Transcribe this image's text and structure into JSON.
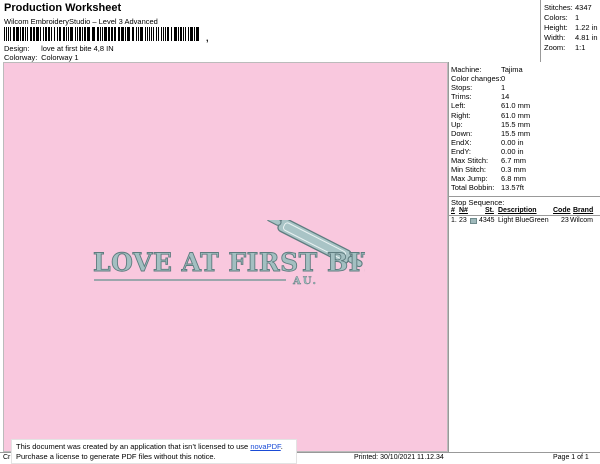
{
  "header": {
    "title": "Production Worksheet",
    "subtitle": "Wilcom EmbroideryStudio – Level 3 Advanced",
    "barcode_trailer": ",",
    "design_label": "Design:",
    "design_value": "love at first bite 4,8 IN",
    "colorway_label": "Colorway:",
    "colorway_value": "Colorway 1"
  },
  "stats": [
    {
      "label": "Stitches:",
      "value": "4347"
    },
    {
      "label": "Colors:",
      "value": "1"
    },
    {
      "label": "Height:",
      "value": "1.22 in"
    },
    {
      "label": "Width:",
      "value": "4.81 in"
    },
    {
      "label": "Zoom:",
      "value": "1:1"
    }
  ],
  "design": {
    "main_text": "LOVE AT FIRST BITE",
    "sub_text": "AU."
  },
  "properties": [
    {
      "label": "Machine:",
      "value": "Tajima"
    },
    {
      "label": "Color changes:",
      "value": "0"
    },
    {
      "label": "Stops:",
      "value": "1"
    },
    {
      "label": "Trims:",
      "value": "14"
    },
    {
      "label": "Left:",
      "value": "61.0 mm"
    },
    {
      "label": "Right:",
      "value": "61.0 mm"
    },
    {
      "label": "Up:",
      "value": "15.5 mm"
    },
    {
      "label": "Down:",
      "value": "15.5 mm"
    },
    {
      "label": "EndX:",
      "value": "0.00 in"
    },
    {
      "label": "EndY:",
      "value": "0.00 in"
    },
    {
      "label": "Max Stitch:",
      "value": "6.7 mm"
    },
    {
      "label": "Min Stitch:",
      "value": "0.3 mm"
    },
    {
      "label": "Max Jump:",
      "value": "6.8 mm"
    },
    {
      "label": "Total Bobbin:",
      "value": "13.57ft"
    }
  ],
  "stop_sequence": {
    "title": "Stop Sequence:",
    "headers": {
      "num": "#",
      "n": "N#",
      "st": "St.",
      "description": "Description",
      "code": "Code",
      "brand": "Brand"
    },
    "rows": [
      {
        "num": "1.",
        "n": "23",
        "swatch_color": "#9fb9bb",
        "st": "4345",
        "description": "Light BlueGreen",
        "code": "23",
        "brand": "Wilcom"
      }
    ]
  },
  "footer": {
    "left": "Cr",
    "printed": "Printed: 30/10/2021 11.12.34",
    "page": "Page 1 of 1"
  },
  "notice": {
    "line1_prefix": "This document was created by an application that isn’t licensed to use ",
    "link": "novaPDF",
    "line1_suffix": ".",
    "line2": "Purchase a license to generate PDF files without this notice."
  },
  "colors": {
    "background": "#f9c8de",
    "thread": "#9fb9bb"
  }
}
